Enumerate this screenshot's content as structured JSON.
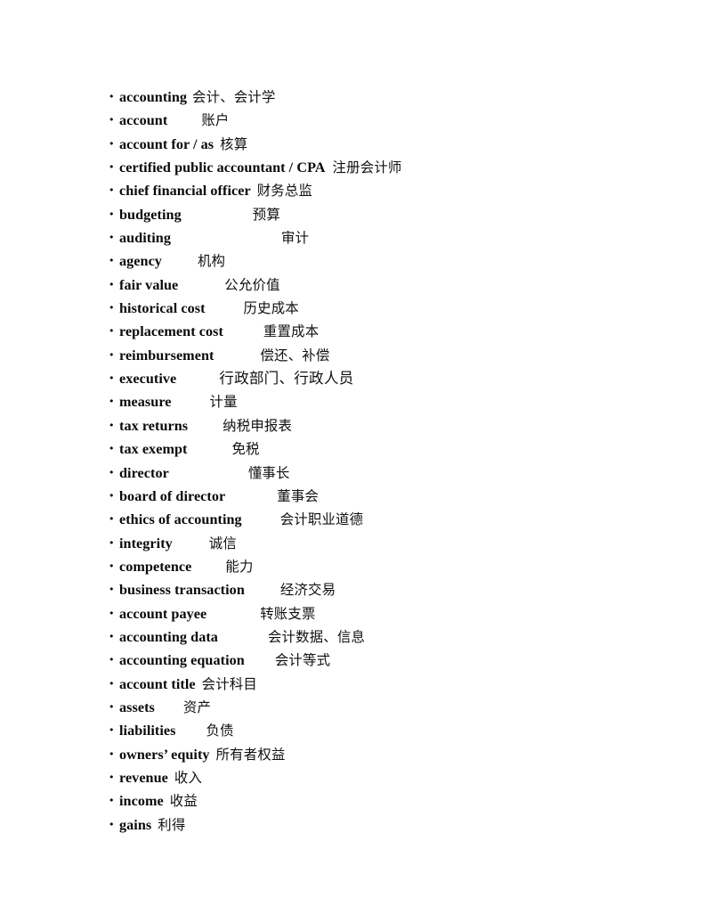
{
  "document": {
    "type": "glossary-list",
    "background_color": "#ffffff",
    "text_color": "#000000",
    "bullet_glyph": "•",
    "items": [
      {
        "en": "accounting",
        "gap": 6,
        "zh": "会计、会计学"
      },
      {
        "en": "account",
        "gap": 38,
        "zh": "账户"
      },
      {
        "en": "account for / as",
        "gap": 7,
        "zh": "核算"
      },
      {
        "en": "certified public accountant / CPA",
        "gap": 8,
        "zh": "注册会计师"
      },
      {
        "en": "chief financial officer",
        "gap": 7,
        "zh": "财务总监"
      },
      {
        "en": "budgeting",
        "gap": 80,
        "zh": "预算"
      },
      {
        "en": "auditing",
        "gap": 124,
        "zh": "审计"
      },
      {
        "en": "agency",
        "gap": 40,
        "zh": "机构"
      },
      {
        "en": "fair value",
        "gap": 52,
        "zh": "公允价值"
      },
      {
        "en": "historical cost",
        "gap": 43,
        "zh": "历史成本"
      },
      {
        "en": "replacement cost",
        "gap": 45,
        "zh": "重置成本"
      },
      {
        "en": "reimbursement",
        "gap": 52,
        "zh": "偿还、补偿"
      },
      {
        "en": "executive",
        "gap": 48,
        "zh": "行政部门、行政人员",
        "zh_large": true
      },
      {
        "en": "measure",
        "gap": 43,
        "zh": "计量"
      },
      {
        "en": "tax returns",
        "gap": 39,
        "zh": "纳税申报表"
      },
      {
        "en": "tax exempt",
        "gap": 50,
        "zh": "免税"
      },
      {
        "en": "director",
        "gap": 89,
        "zh": "懂事长"
      },
      {
        "en": "board of director",
        "gap": 58,
        "zh": "董事会"
      },
      {
        "en": "ethics of accounting",
        "gap": 43,
        "zh": "会计职业道德"
      },
      {
        "en": "integrity",
        "gap": 41,
        "zh": "诚信"
      },
      {
        "en": "competence",
        "gap": 38,
        "zh": "能力"
      },
      {
        "en": "business transaction",
        "gap": 40,
        "zh": "经济交易"
      },
      {
        "en": "account payee",
        "gap": 60,
        "zh": "转账支票"
      },
      {
        "en": "accounting data",
        "gap": 56,
        "zh": "会计数据、信息"
      },
      {
        "en": "accounting equation",
        "gap": 34,
        "zh": "会计等式"
      },
      {
        "en": "account title",
        "gap": 7,
        "zh": "会计科目"
      },
      {
        "en": "assets",
        "gap": 32,
        "zh": "资产"
      },
      {
        "en": "liabilities",
        "gap": 34,
        "zh": "负债"
      },
      {
        "en": "owners’ equity",
        "gap": 7,
        "zh": "所有者权益"
      },
      {
        "en": "revenue",
        "gap": 7,
        "zh": "收入"
      },
      {
        "en": "income",
        "gap": 7,
        "zh": "收益"
      },
      {
        "en": "gains",
        "gap": 7,
        "zh": "利得"
      }
    ]
  }
}
